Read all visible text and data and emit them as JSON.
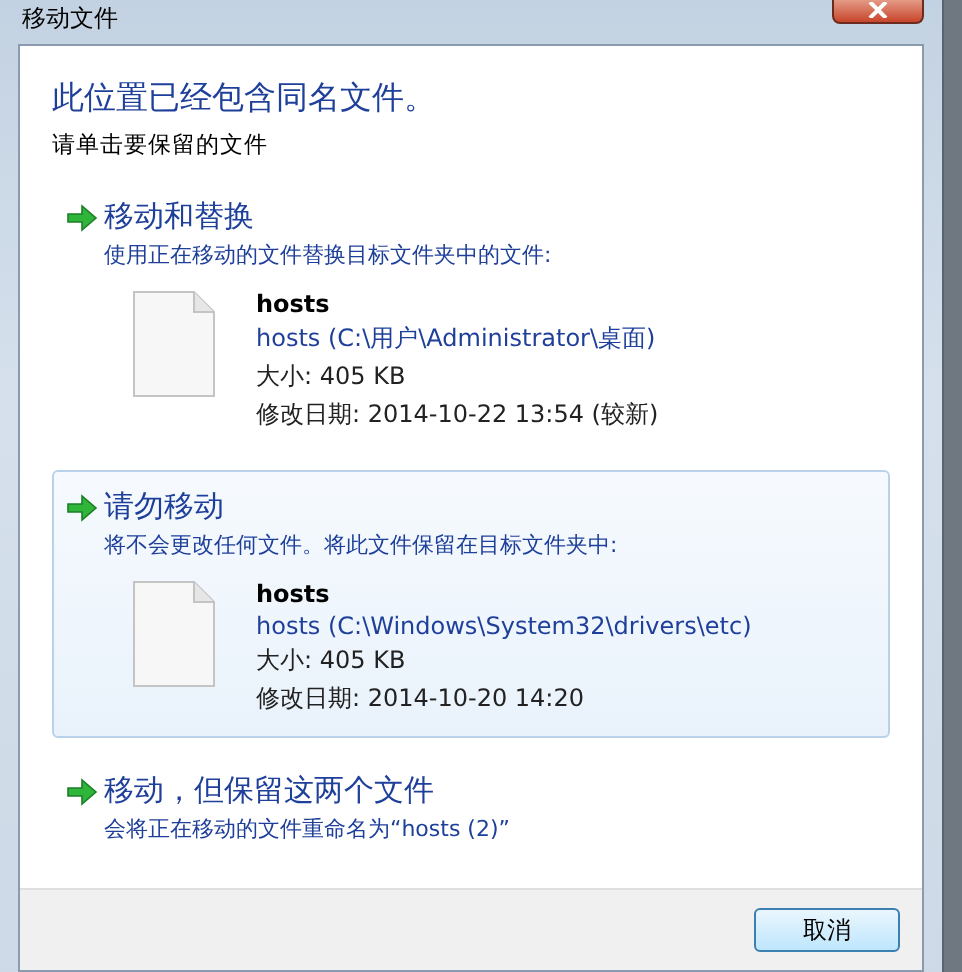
{
  "window": {
    "title": "移动文件"
  },
  "heading": "此位置已经包含同名文件。",
  "instruction": "请单击要保留的文件",
  "options": [
    {
      "title": "移动和替换",
      "description": "使用正在移动的文件替换目标文件夹中的文件:",
      "selected": false,
      "file": {
        "name": "hosts",
        "path": "hosts (C:\\用户\\Administrator\\桌面)",
        "size": "大小: 405 KB",
        "modified": "修改日期: 2014-10-22 13:54 (较新)"
      }
    },
    {
      "title": "请勿移动",
      "description": "将不会更改任何文件。将此文件保留在目标文件夹中:",
      "selected": true,
      "file": {
        "name": "hosts",
        "path": "hosts (C:\\Windows\\System32\\drivers\\etc)",
        "size": "大小: 405 KB",
        "modified": "修改日期: 2014-10-20 14:20"
      }
    },
    {
      "title": "移动，但保留这两个文件",
      "description": "会将正在移动的文件重命名为“hosts (2)”",
      "selected": false
    }
  ],
  "buttons": [
    "取消"
  ]
}
